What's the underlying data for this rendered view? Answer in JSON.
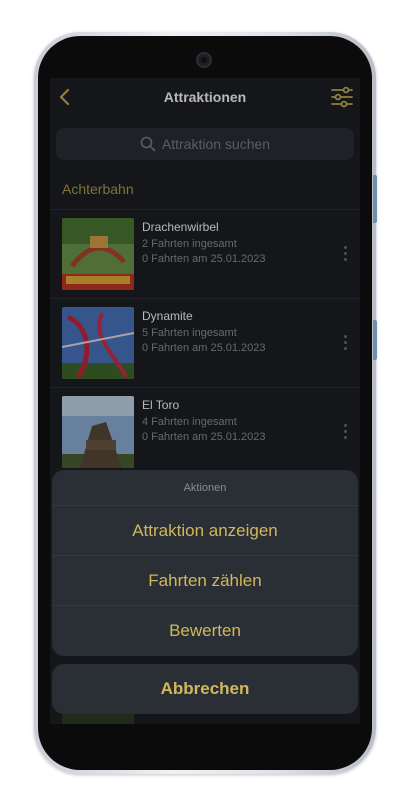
{
  "header": {
    "title": "Attraktionen"
  },
  "search": {
    "placeholder": "Attraktion suchen"
  },
  "section": {
    "title": "Achterbahn"
  },
  "rides": [
    {
      "name": "Drachenwirbel",
      "total": "2 Fahrten ingesamt",
      "today": "0 Fahrten am 25.01.2023"
    },
    {
      "name": "Dynamite",
      "total": "5 Fahrten ingesamt",
      "today": "0 Fahrten am 25.01.2023"
    },
    {
      "name": "El Toro",
      "total": "4 Fahrten ingesamt",
      "today": "0 Fahrten am 25.01.2023"
    }
  ],
  "action_sheet": {
    "title": "Aktionen",
    "items": [
      "Attraktion anzeigen",
      "Fahrten zählen",
      "Bewerten"
    ],
    "cancel": "Abbrechen"
  },
  "colors": {
    "background": "#1c1f24",
    "accent": "#d1b85a",
    "section": "#b59e47",
    "sheet": "#2a2e35"
  }
}
